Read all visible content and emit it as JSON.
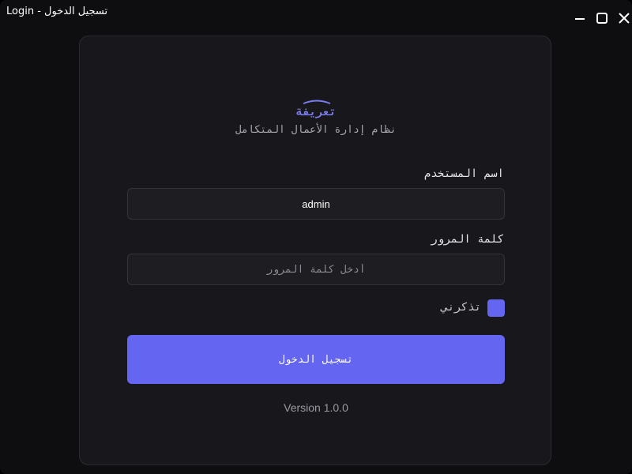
{
  "window": {
    "title": "Login - تسجيل الدخول"
  },
  "brand": {
    "name": "تعريفة",
    "subtitle": "نظام إدارة الأعمال المتكامل",
    "accent_color": "#6466f1"
  },
  "form": {
    "username_label": "اسم المستخدم",
    "username_value": "admin",
    "password_label": "كلمة المرور",
    "password_placeholder": "أدخل كلمة المرور",
    "remember_label": "تذكرني",
    "remember_checked": true,
    "submit_label": "تسجيل الدخول"
  },
  "footer": {
    "version": "Version 1.0.0"
  },
  "icons": {
    "minimize": "minimize-icon",
    "maximize": "maximize-icon",
    "close": "close-icon",
    "logo": "logo-arc"
  }
}
